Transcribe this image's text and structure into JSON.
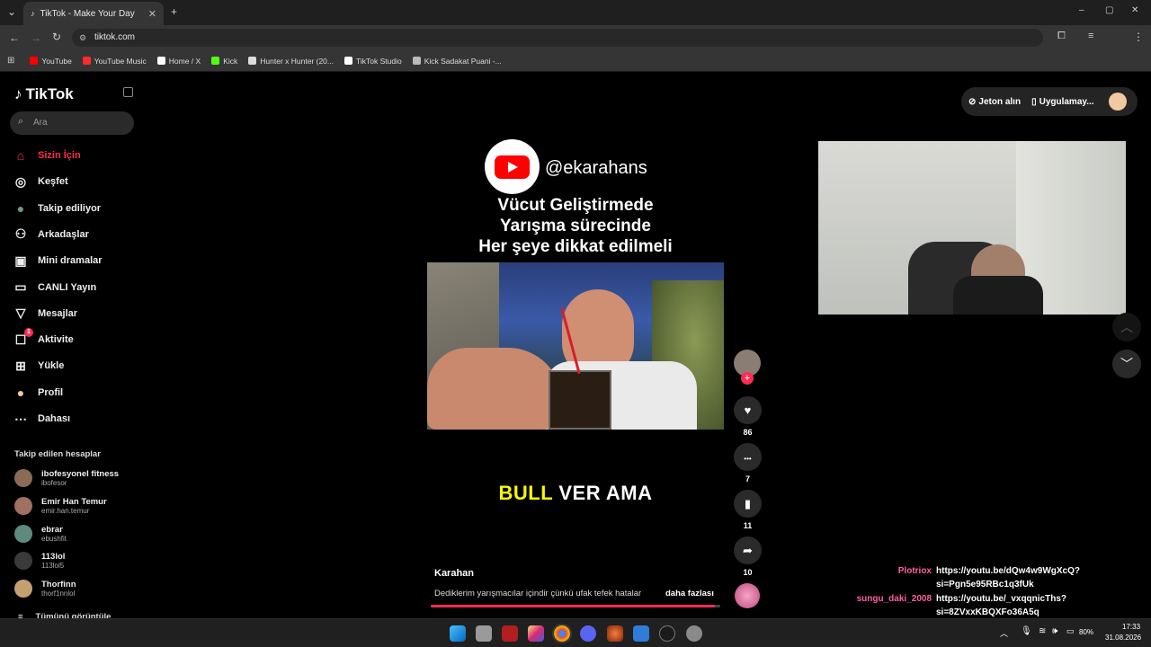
{
  "browser": {
    "tab_title": "TikTok - Make Your Day",
    "url": "tiktok.com",
    "bookmarks": [
      {
        "label": "YouTube",
        "color": "#ff0000"
      },
      {
        "label": "YouTube Music",
        "color": "#ff2b2b"
      },
      {
        "label": "Home / X",
        "color": "#ffffff"
      },
      {
        "label": "Kick",
        "color": "#53fc18"
      },
      {
        "label": "Hunter x Hunter (20...",
        "color": "#dddddd"
      },
      {
        "label": "TikTok Studio",
        "color": "#ffffff"
      },
      {
        "label": "Kick Sadakat Puani -...",
        "color": "#bbbbbb"
      }
    ]
  },
  "sidebar": {
    "logo": "TikTok",
    "search_placeholder": "Ara",
    "nav": [
      {
        "label": "Sizin İçin",
        "icon": "home-icon",
        "active": true
      },
      {
        "label": "Keşfet",
        "icon": "compass-icon"
      },
      {
        "label": "Takip ediliyor",
        "icon": "following-avatar-icon"
      },
      {
        "label": "Arkadaşlar",
        "icon": "friends-icon"
      },
      {
        "label": "Mini dramalar",
        "icon": "film-icon"
      },
      {
        "label": "CANLI Yayın",
        "icon": "live-icon"
      },
      {
        "label": "Mesajlar",
        "icon": "send-icon"
      },
      {
        "label": "Aktivite",
        "icon": "activity-icon",
        "badge": "1"
      },
      {
        "label": "Yükle",
        "icon": "upload-icon"
      },
      {
        "label": "Profil",
        "icon": "profile-avatar-icon"
      },
      {
        "label": "Dahası",
        "icon": "more-icon"
      }
    ],
    "following_title": "Takip edilen hesaplar",
    "following": [
      {
        "name": "ibofesyonel fitness",
        "handle": "ibofesor"
      },
      {
        "name": "Emir Han Temur",
        "handle": "emir.han.temur"
      },
      {
        "name": "ebrar",
        "handle": "ebushfit"
      },
      {
        "name": "113lol",
        "handle": "113lol5"
      },
      {
        "name": "Thorfinn",
        "handle": "thorf1nnlol"
      }
    ],
    "see_all": "Tümünü görüntüle"
  },
  "header": {
    "coins": "Jeton alın",
    "app": "Uygulamay..."
  },
  "video": {
    "yt_handle": "@ekarahans",
    "title_lines": [
      "Vücut Geliştirmede",
      "Yarışma sürecinde",
      "Her şeye dikkat edilmeli"
    ],
    "caption_yellow": "BULL",
    "caption_white": "VER AMA",
    "author": "Karahan",
    "description": "Dediklerim yarışmacılar içindir çünkü ufak tefek hatalar",
    "more": "daha fazlası",
    "progress": 0.98
  },
  "actions": {
    "likes": "86",
    "comments": "7",
    "saves": "11",
    "shares": "10"
  },
  "chat": [
    {
      "user": "Plotriox",
      "user_color": "#ff5fa2",
      "text": "https://youtu.be/dQw4w9WgXcQ?",
      "text2": "si=Pgn5e95RBc1q3fUk"
    },
    {
      "user": "sungu_daki_2008",
      "user_color": "#ff5fa2",
      "text": "https://youtu.be/_vxqqnicThs?",
      "text2": "si=8ZVxxKBQXFo36A5q"
    }
  ],
  "taskbar": {
    "battery": "80%",
    "time": "17:33",
    "date": "31.08.2026"
  }
}
